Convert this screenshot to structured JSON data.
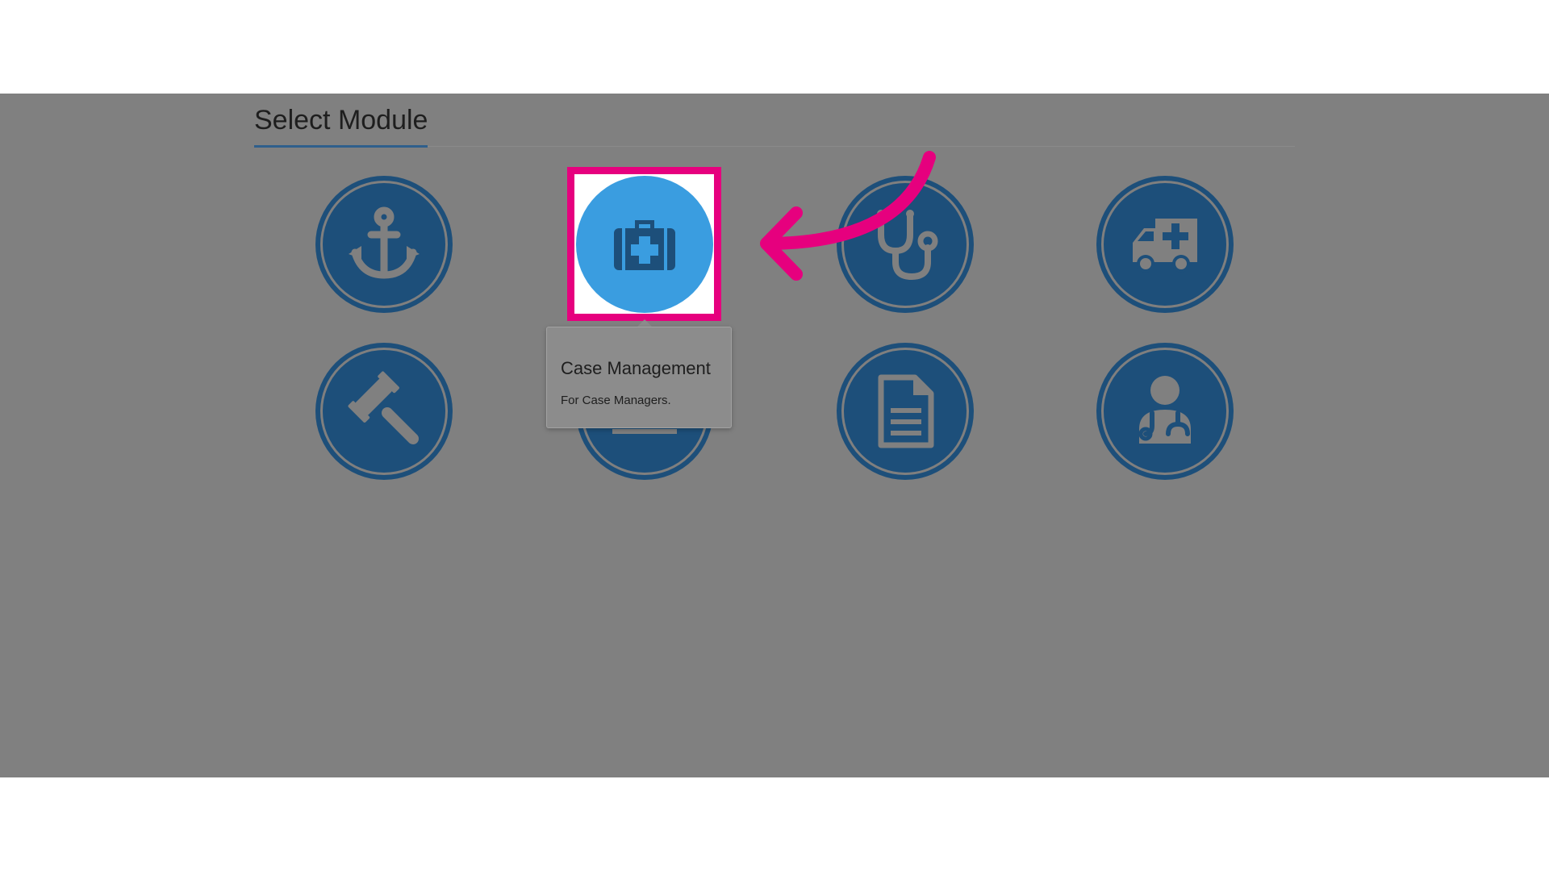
{
  "header": {
    "title": "Select Module"
  },
  "modules": [
    {
      "icon": "anchor-icon"
    },
    {
      "icon": "medical-kit-icon",
      "active": true
    },
    {
      "icon": "stethoscope-icon"
    },
    {
      "icon": "ambulance-icon"
    },
    {
      "icon": "gavel-icon"
    },
    {
      "icon": "chart-icon"
    },
    {
      "icon": "document-icon"
    },
    {
      "icon": "doctor-icon"
    }
  ],
  "tooltip": {
    "title": "Case Management",
    "description": "For Case Managers."
  },
  "colors": {
    "overlay": "#808080",
    "module_bg": "#1d4f7a",
    "active_bg": "#3a9de0",
    "highlight": "#e6007e",
    "accent": "#2f5f8c"
  }
}
